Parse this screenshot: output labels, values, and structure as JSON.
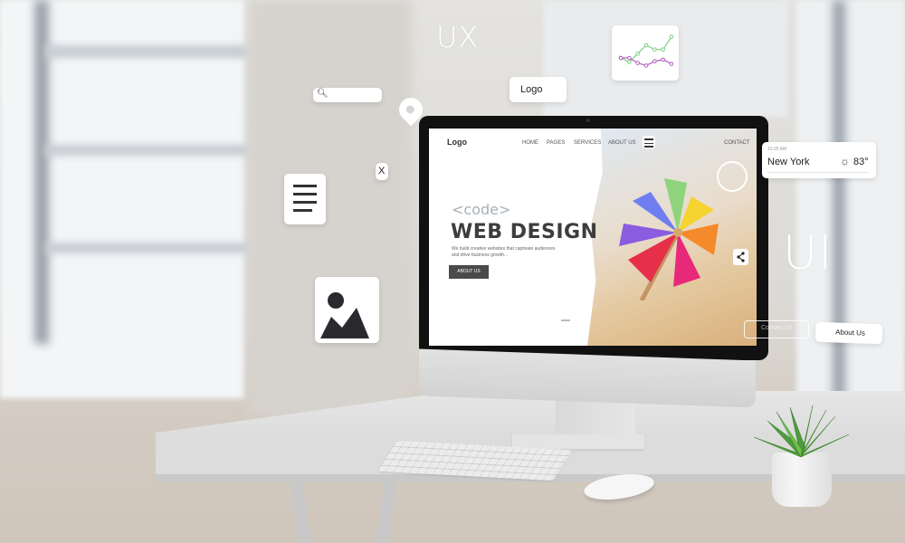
{
  "scene": {
    "description": "Desktop computer on white desk with floating web design UI elements",
    "floating_labels": {
      "ux": "UX",
      "ui": "UI"
    },
    "floating_cards": {
      "search_bar_placeholder": "",
      "logo_card": "Logo",
      "close_card": "X",
      "about_card": "About Us",
      "ghost_button": "Contact Us"
    },
    "weather_widget": {
      "time": "10:25 AM",
      "city": "New York",
      "temperature": "83°",
      "icon": "sun-icon"
    },
    "mini_chart": {
      "series": [
        {
          "name": "green",
          "color": "#7ccf86",
          "values": [
            3,
            2,
            4,
            6,
            5,
            5,
            8
          ]
        },
        {
          "name": "purple",
          "color": "#b45cc4",
          "values": [
            3,
            3,
            1.8,
            1.2,
            2.2,
            2.6,
            1.6
          ]
        }
      ]
    }
  },
  "website": {
    "logo": "Logo",
    "nav": [
      "HOME",
      "PAGES",
      "SERVICES",
      "ABOUT US",
      "CONTACT"
    ],
    "hero": {
      "eyebrow": "<code>",
      "title": "WEB DESIGN",
      "description": "We build creative websites that captivate audiences and drive business growth...",
      "cta": "ABOUT US"
    }
  },
  "colors": {
    "button_dark": "#4a4a4a",
    "title_dark": "#3d3d3d",
    "eyebrow_gray": "#a8b0b8"
  }
}
